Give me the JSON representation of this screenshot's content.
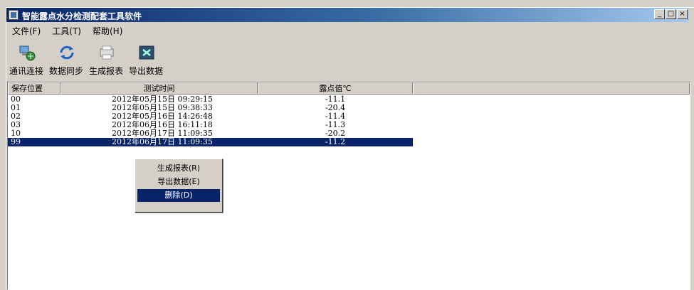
{
  "window": {
    "title": "智能露点水分检测配套工具软件",
    "controls": {
      "minimize": "_",
      "maximize": "□",
      "close": "×"
    }
  },
  "menu": [
    "文件(F)",
    "工具(T)",
    "帮助(H)"
  ],
  "toolbar": [
    {
      "label": "通讯连接",
      "icon": "network-connect-icon"
    },
    {
      "label": "数据同步",
      "icon": "data-sync-icon"
    },
    {
      "label": "生成报表",
      "icon": "report-icon"
    },
    {
      "label": "导出数据",
      "icon": "export-icon"
    }
  ],
  "table": {
    "columns": [
      "保存位置",
      "测试时间",
      "露点值℃"
    ],
    "rows": [
      {
        "pos": "00",
        "time": "2012年05月15日 09:29:15",
        "value": "-11.1"
      },
      {
        "pos": "01",
        "time": "2012年05月15日 09:38:33",
        "value": "-20.4"
      },
      {
        "pos": "02",
        "time": "2012年05月16日 14:26:48",
        "value": "-11.4"
      },
      {
        "pos": "03",
        "time": "2012年06月16日 16:11:18",
        "value": "-11.3"
      },
      {
        "pos": "10",
        "time": "2012年06月17日 11:09:35",
        "value": "-20.2"
      },
      {
        "pos": "99",
        "time": "2012年06月17日 11:09:35",
        "value": "-11.2",
        "selected": true
      }
    ]
  },
  "context_menu": [
    {
      "label": "生成报表(R)"
    },
    {
      "label": "导出数据(E)"
    },
    {
      "label": "删除(D)",
      "highlighted": true
    }
  ]
}
